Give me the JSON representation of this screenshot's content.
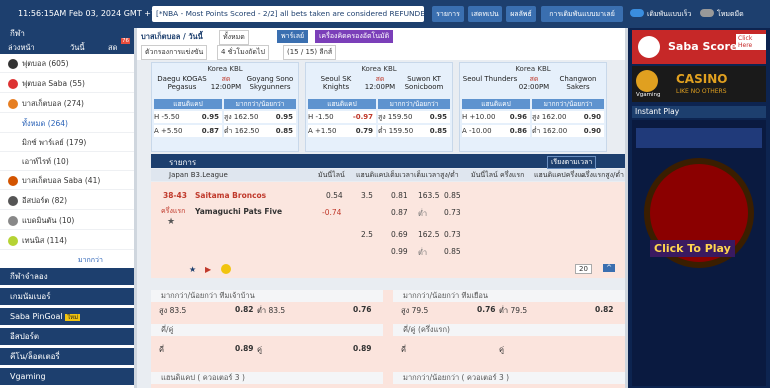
{
  "topbar": {
    "clock": "11:56:15AM Feb 03, 2024 GMT +7",
    "ticker": "[*NBA - Most Points Scored - 2/2] all bets taken are considered REFUNDED.",
    "btn_results": "รายการ",
    "btn_statement": "เสดทเปน",
    "btn_result2": "ผลลัพธ์",
    "btn_settings": "การเดิมพันแบบมาเลย์",
    "toggle1": "เดิมพันแบบเร็ว",
    "toggle2": "โหมดมืด",
    "colors": {
      "bar": "#1d3f6e",
      "accent": "#3a6fb0"
    }
  },
  "sidebar": {
    "tab_header": "กีฬา",
    "tabs": [
      "ล่วงหน้า",
      "วันนี้",
      "สด"
    ],
    "live_badge": "76",
    "items": [
      {
        "label": "ฟุตบอล",
        "count": "(605)"
      },
      {
        "label": "ฟุตบอล Saba",
        "count": "(55)"
      },
      {
        "label": "บาสเก็ตบอล",
        "count": "(274)"
      }
    ],
    "sub_items": [
      {
        "label": "ทั้งหมด",
        "count": "(264)"
      },
      {
        "label": "มิกซ์ พาร์เลย์",
        "count": "(179)"
      },
      {
        "label": "เอาท์ไรท์",
        "count": "(10)"
      }
    ],
    "items2": [
      {
        "label": "บาสเก็ตบอล Saba",
        "count": "(41)"
      },
      {
        "label": "อีสปอร์ต",
        "count": "(82)"
      },
      {
        "label": "แบดมินตัน",
        "count": "(10)"
      },
      {
        "label": "เทนนิส",
        "count": "(114)"
      }
    ],
    "more": "มากกว่า",
    "sections": [
      "กีฬาจำลอง",
      "เกมนัมเบอร์",
      "Saba PinGoal",
      "อีสปอร์ต",
      "คีโน/ล็อตเตอรี่",
      "Vgaming"
    ],
    "new_badge": "ใหม่"
  },
  "filters": {
    "sport": "บาสเก็ตบอล / วันนี้",
    "sort": "ทั้งหมด",
    "parlay": "พาร์เลย์",
    "quick": "เครื่องคิดครองอัตโนมัติ",
    "filter1": "ตัวกรองการแข่งขัน",
    "filter2": "4 ชั่วโมงถัดไป",
    "count": "(15 / 15) ลีกส์"
  },
  "featured": [
    {
      "league": "Korea KBL",
      "home": "Daegu KOGAS Pegasus",
      "away": "Goyang Sono Skygunners",
      "status": "สด",
      "time": "12:00PM",
      "hdp_h": "H -5.50",
      "hdp_h_odds": "0.95",
      "hdp_a": "A +5.50",
      "hdp_a_odds": "0.87",
      "ou_o": "สูง 162.50",
      "ou_o_odds": "0.95",
      "ou_u": "ต่ำ 162.50",
      "ou_u_odds": "0.85"
    },
    {
      "league": "Korea KBL",
      "home": "Seoul SK Knights",
      "away": "Suwon KT Sonicboom",
      "status": "สด",
      "time": "12:00PM",
      "hdp_h": "H -1.50",
      "hdp_h_odds": "-0.97",
      "hdp_a": "A +1.50",
      "hdp_a_odds": "0.79",
      "ou_o": "สูง 159.50",
      "ou_o_odds": "0.95",
      "ou_u": "ต่ำ 159.50",
      "ou_u_odds": "0.85"
    },
    {
      "league": "Korea KBL",
      "home": "Seoul Thunders",
      "away": "Changwon Sakers",
      "status": "สด",
      "time": "02:00PM",
      "hdp_h": "H +10.00",
      "hdp_h_odds": "0.96",
      "hdp_a": "A -10.00",
      "hdp_a_odds": "0.86",
      "ou_o": "สูง 162.00",
      "ou_o_odds": "0.90",
      "ou_u": "ต่ำ 162.00",
      "ou_u_odds": "0.90"
    }
  ],
  "featured_labels": {
    "hdp": "แฮนดิแคป",
    "ou": "มากกว่า/น้อยกว่า"
  },
  "list": {
    "title": "รายการ",
    "sort": "เรียงตามเวลา",
    "league": "Japan B3.League",
    "cols": [
      "มันนี่ไลน์",
      "แฮนดิแคปเต็มเวลา",
      "เต็มเวลาสูง/ต่ำ",
      "มันนี่ไลน์ ครึ่งแรก",
      "แฮนดิแคปครึ่งแ...",
      "ครึ่งแรกสูง/ต่ำ"
    ],
    "score": "38-43",
    "period": "ครึ่งแรก",
    "home": "Saitama Broncos",
    "away": "Yamaguchi Pats Five",
    "ml_h": "0.54",
    "ml_a": "-0.74",
    "hdp1": "3.5",
    "hdp1_o": "0.81",
    "hdp1_u": "0.87",
    "ou1": "163.5",
    "ou1_o": "0.85",
    "ou1_u": "0.73",
    "low": "ต่ำ",
    "hdp2": "2.5",
    "hdp2_o": "0.69",
    "hdp2_u": "0.99",
    "ou2": "162.5",
    "ou2_o": "0.73",
    "ou2_u": "0.85",
    "page_size": "20"
  },
  "markets": [
    {
      "title": "มากกว่า/น้อยกว่า ทีมเจ้าบ้าน",
      "o": "สูง 83.5",
      "o_odds": "0.82",
      "u": "ต่ำ 83.5",
      "u_odds": "0.76"
    },
    {
      "title": "มากกว่า/น้อยกว่า ทีมเยือน",
      "o": "สูง 79.5",
      "o_odds": "0.76",
      "u": "ต่ำ 79.5",
      "u_odds": "0.82"
    },
    {
      "title": "คี่/คู่",
      "o": "คี่",
      "o_odds": "0.89",
      "u": "คู่",
      "u_odds": "0.89"
    },
    {
      "title": "คี่/คู่ (ครึ่งแรก)",
      "o": "คี่",
      "o_odds": "",
      "u": "คู่",
      "u_odds": ""
    },
    {
      "title": "แฮนดิแคป ( ควอเตอร์ 3 )"
    },
    {
      "title": "มากกว่า/น้อยกว่า ( ควอเตอร์ 3 )"
    }
  ],
  "right": {
    "banner1": "Saba Score",
    "banner1b": "Click Here",
    "banner2": "CASINO",
    "banner2b": "Vgaming",
    "banner2c": "LIKE NO OTHERS",
    "instant": "Instant Play",
    "cta": "Click To Play"
  }
}
